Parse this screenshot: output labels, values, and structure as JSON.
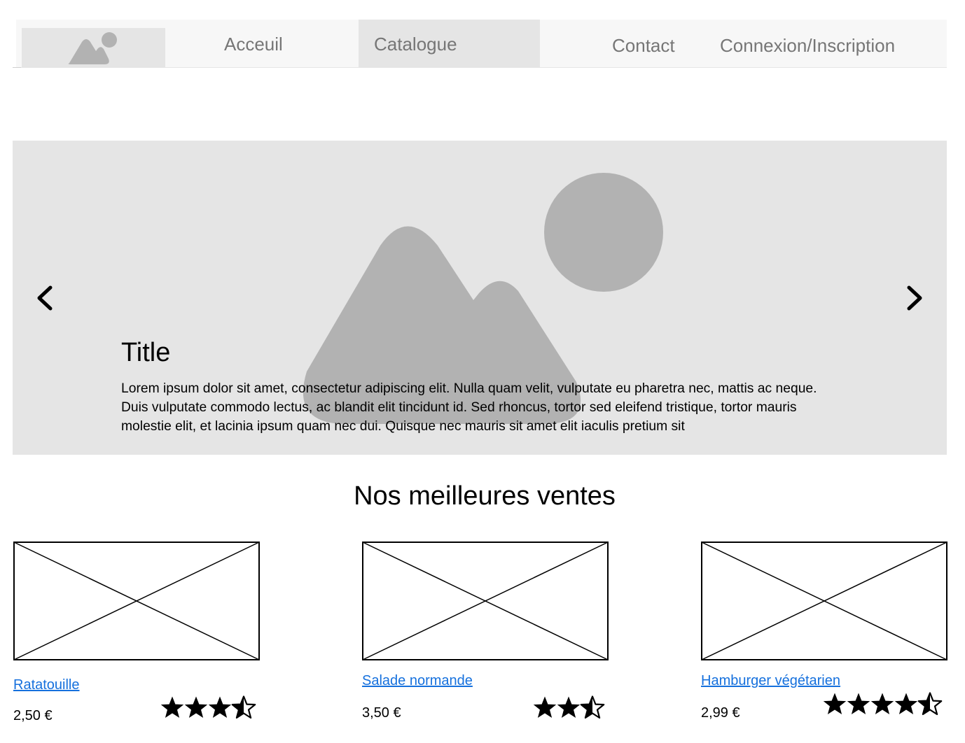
{
  "nav": {
    "logo_icon": "image-placeholder-icon",
    "items": [
      {
        "label": "Acceuil",
        "active": false
      },
      {
        "label": "Catalogue",
        "active": true
      },
      {
        "label": "Contact",
        "active": false
      },
      {
        "label": "Connexion/Inscription",
        "active": false
      }
    ]
  },
  "carousel": {
    "image_icon": "image-placeholder-icon",
    "prev_icon": "chevron-left-icon",
    "next_icon": "chevron-right-icon",
    "title": "Title",
    "text": "Lorem ipsum dolor sit amet, consectetur adipiscing elit. Nulla quam velit, vulputate eu pharetra nec, mattis ac neque. Duis vulputate commodo lectus, ac blandit elit tincidunt id. Sed rhoncus, tortor sed eleifend tristique, tortor mauris molestie elit, et lacinia ipsum quam nec dui. Quisque nec mauris sit amet elit iaculis pretium sit"
  },
  "best_sellers": {
    "title": "Nos meilleures ventes",
    "products": [
      {
        "name": "Ratatouille",
        "price": "2,50 €",
        "rating": 3.5,
        "max_rating": 4
      },
      {
        "name": "Salade normande",
        "price": "3,50 €",
        "rating": 2.5,
        "max_rating": 3
      },
      {
        "name": "Hamburger végétarien",
        "price": "2,99 €",
        "rating": 4.5,
        "max_rating": 5
      }
    ]
  },
  "colors": {
    "nav_bg": "#f7f7f7",
    "placeholder_bg": "#e5e5e5",
    "placeholder_shape": "#b2b2b2",
    "nav_text": "#767676",
    "link": "#1570dd"
  }
}
